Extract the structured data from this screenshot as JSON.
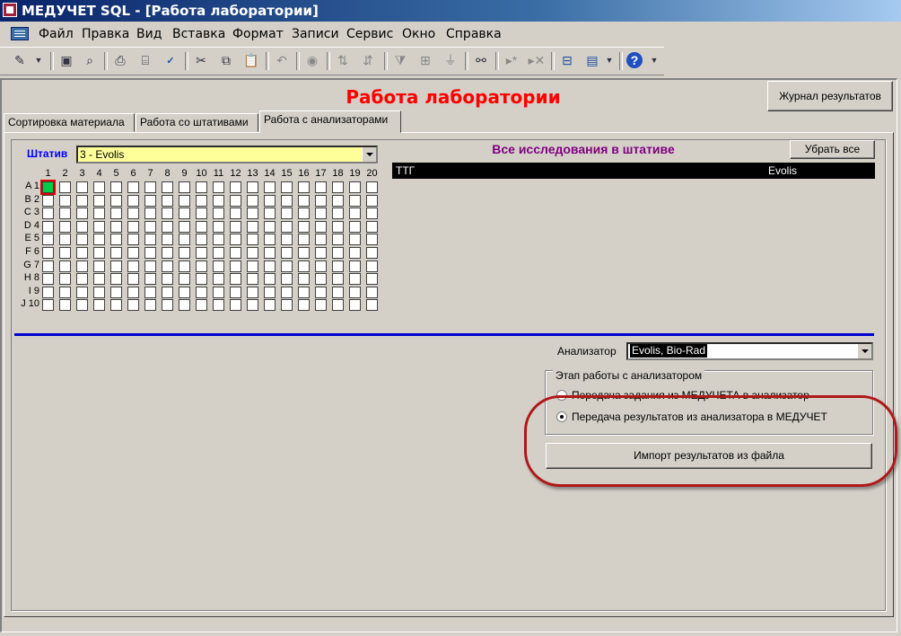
{
  "window": {
    "title": "МЕДУЧЕТ SQL - [Работа лаборатории]"
  },
  "menu": [
    "Файл",
    "Правка",
    "Вид",
    "Вставка",
    "Формат",
    "Записи",
    "Сервис",
    "Окно",
    "Справка"
  ],
  "toolbar_icons": [
    "design-view-icon",
    "save-icon",
    "search-file-icon",
    "print-icon",
    "print-preview-icon",
    "spelling-icon",
    "cut-icon",
    "copy-icon",
    "paste-icon",
    "undo-icon",
    "hyperlink-icon",
    "sort-ascending-icon",
    "sort-descending-icon",
    "filter-selection-icon",
    "filter-form-icon",
    "apply-filter-icon",
    "find-icon",
    "new-record-icon",
    "delete-record-icon",
    "properties-icon",
    "new-object-icon",
    "help-icon"
  ],
  "form": {
    "heading": "Работа лаборатории",
    "journal_button": "Журнал результатов",
    "tabs": [
      "Сортировка материала",
      "Работа со штативами",
      "Работа с анализаторами"
    ],
    "active_tab": 2
  },
  "rack": {
    "label": "Штатив",
    "selected": "3 - Evolis",
    "columns": [
      "1",
      "2",
      "3",
      "4",
      "5",
      "6",
      "7",
      "8",
      "9",
      "10",
      "11",
      "12",
      "13",
      "14",
      "15",
      "16",
      "17",
      "18",
      "19",
      "20"
    ],
    "rows": [
      "A 1",
      "B 2",
      "C 3",
      "D 4",
      "E 5",
      "F 6",
      "G 7",
      "H 8",
      "I 9",
      "J 10"
    ],
    "selected_cell": {
      "row": "A 1",
      "column": "1"
    }
  },
  "studies": {
    "title": "Все исследования в штативе",
    "clear_button": "Убрать все",
    "rows": [
      {
        "test": "ТТГ",
        "analyzer": "Evolis"
      }
    ]
  },
  "analyzer": {
    "label": "Анализатор",
    "value": "Evolis, Bio-Rad"
  },
  "stage": {
    "legend": "Этап работы с анализатором",
    "options": [
      "Передача задания из МЕДУЧЕТА в анализатор",
      "Передача результатов из анализатора в МЕДУЧЕТ"
    ],
    "selected_index": 1,
    "import_button": "Импорт результатов из файла"
  },
  "colors": {
    "heading": "#ff0000",
    "rack_label": "#0000ff",
    "list_title": "#800080",
    "combo_bg": "#ffff99",
    "selected_cell": "#00cc44",
    "annotation": "#b01818"
  }
}
